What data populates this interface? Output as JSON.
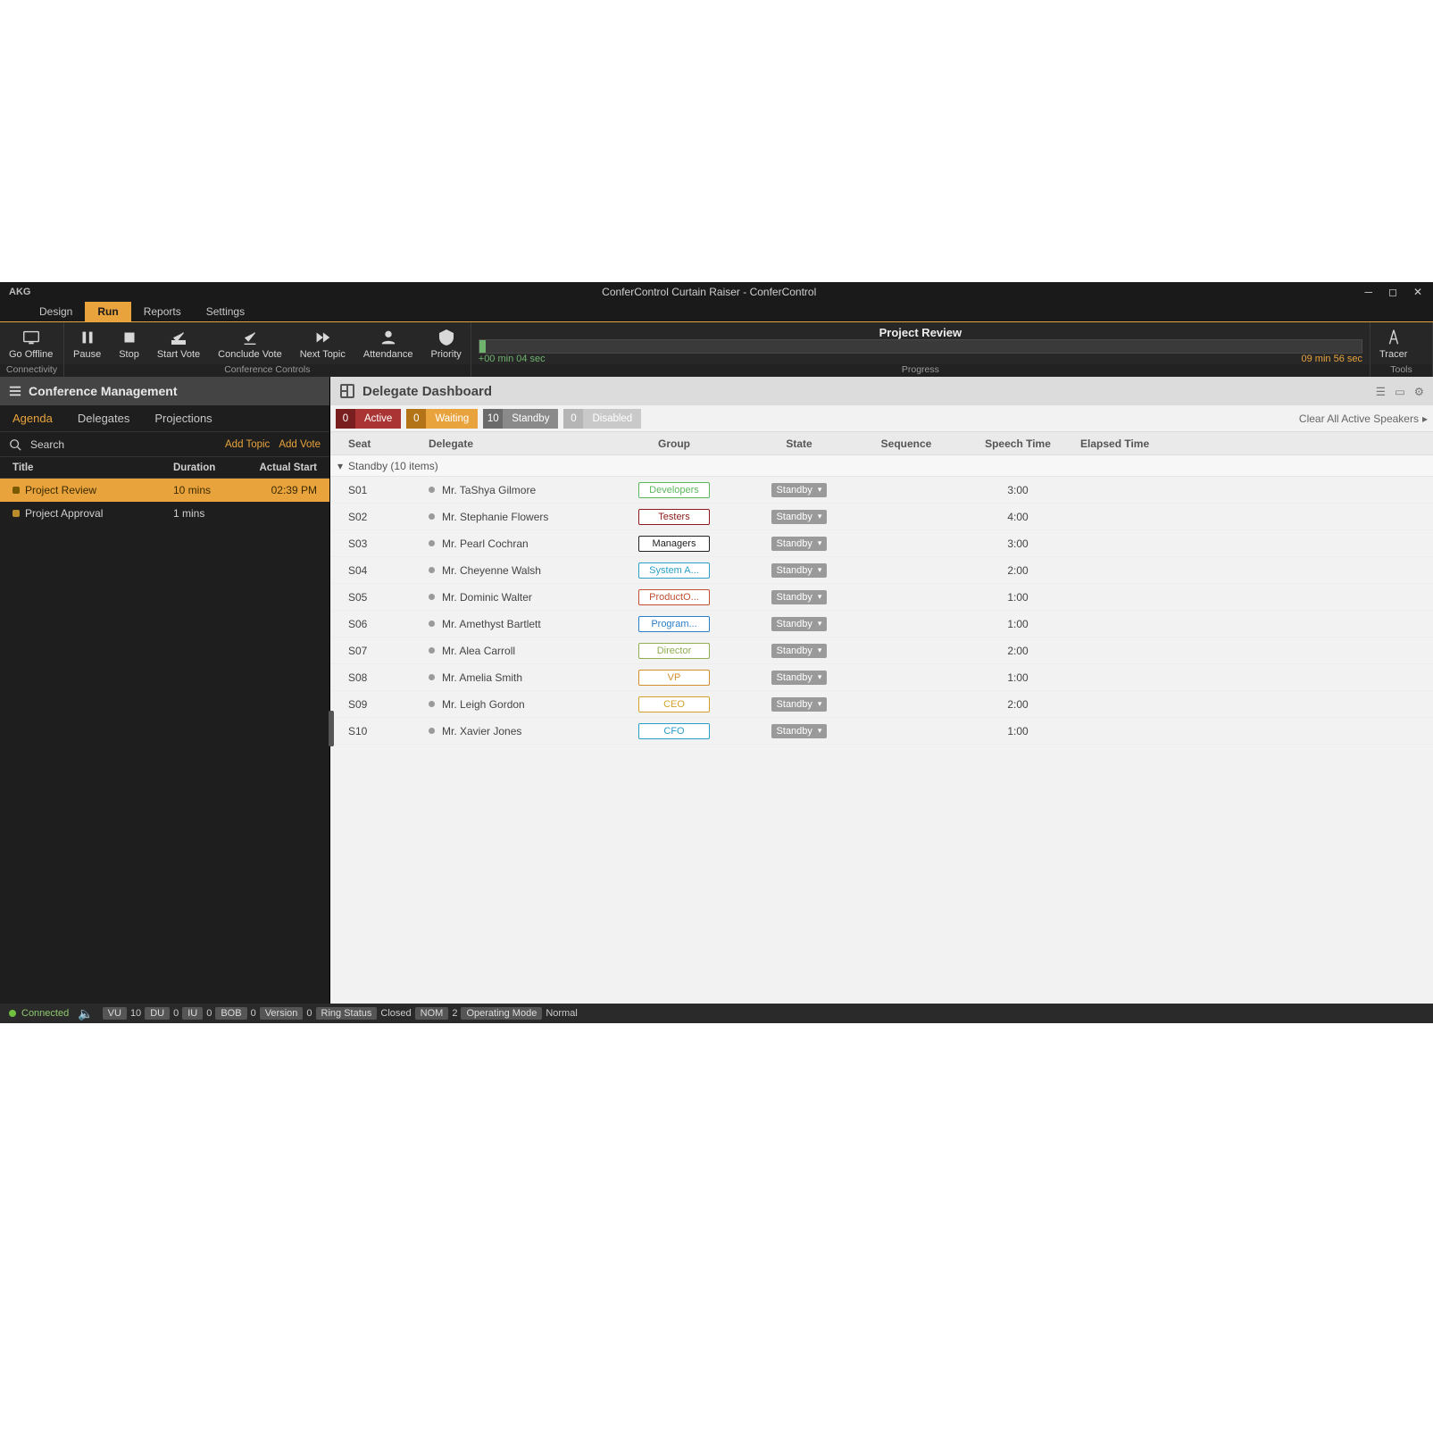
{
  "app": {
    "brand": "AKG",
    "title": "ConferControl Curtain Raiser - ConferControl"
  },
  "menu": [
    "Design",
    "Run",
    "Reports",
    "Settings"
  ],
  "menu_active_index": 1,
  "ribbon": {
    "connectivity": {
      "label": "Connectivity",
      "buttons": [
        {
          "id": "go-offline",
          "label": "Go Offline"
        }
      ]
    },
    "conference": {
      "label": "Conference Controls",
      "buttons": [
        {
          "id": "pause",
          "label": "Pause"
        },
        {
          "id": "stop",
          "label": "Stop"
        },
        {
          "id": "start-vote",
          "label": "Start Vote"
        },
        {
          "id": "conclude-vote",
          "label": "Conclude Vote"
        },
        {
          "id": "next-topic",
          "label": "Next Topic"
        },
        {
          "id": "attendance",
          "label": "Attendance"
        },
        {
          "id": "priority",
          "label": "Priority"
        }
      ]
    },
    "progress": {
      "label": "Progress",
      "title": "Project Review",
      "elapsed": "+00 min  04 sec",
      "remaining": "09 min  56 sec",
      "percent": 0.7
    },
    "tools": {
      "label": "Tools",
      "buttons": [
        {
          "id": "tracer",
          "label": "Tracer"
        }
      ]
    }
  },
  "sidebar": {
    "title": "Conference Management",
    "tabs": [
      "Agenda",
      "Delegates",
      "Projections"
    ],
    "active_tab": 0,
    "search_label": "Search",
    "add_topic": "Add Topic",
    "add_vote": "Add Vote",
    "columns": {
      "title": "Title",
      "duration": "Duration",
      "actual_start": "Actual Start"
    },
    "rows": [
      {
        "title": "Project Review",
        "duration": "10 mins",
        "start": "02:39 PM",
        "selected": true
      },
      {
        "title": "Project Approval",
        "duration": "1 mins",
        "start": "",
        "selected": false
      }
    ]
  },
  "dashboard": {
    "title": "Delegate Dashboard",
    "filters": [
      {
        "id": "active",
        "count": 0,
        "label": "Active"
      },
      {
        "id": "waiting",
        "count": 0,
        "label": "Waiting"
      },
      {
        "id": "standby",
        "count": 10,
        "label": "Standby"
      },
      {
        "id": "disabled",
        "count": 0,
        "label": "Disabled"
      }
    ],
    "clear_link": "Clear All Active Speakers",
    "columns": [
      "Seat",
      "Delegate",
      "Group",
      "State",
      "Sequence",
      "Speech Time",
      "Elapsed Time"
    ],
    "group_header": "Standby (10 items)",
    "group_colors": {
      "Developers": "#5cb85c",
      "Testers": "#8b1a1a",
      "Managers": "#222222",
      "System A...": "#2aa0c8",
      "ProductO...": "#c05030",
      "Program...": "#2a7ec8",
      "Director": "#8fae4f",
      "VP": "#d48f2a",
      "CEO": "#d4a02a",
      "CFO": "#2a9cc8"
    },
    "rows": [
      {
        "seat": "S01",
        "delegate": "Mr. TaShya Gilmore",
        "group": "Developers",
        "state": "Standby",
        "speech": "3:00"
      },
      {
        "seat": "S02",
        "delegate": "Mr. Stephanie Flowers",
        "group": "Testers",
        "state": "Standby",
        "speech": "4:00"
      },
      {
        "seat": "S03",
        "delegate": "Mr. Pearl Cochran",
        "group": "Managers",
        "state": "Standby",
        "speech": "3:00"
      },
      {
        "seat": "S04",
        "delegate": "Mr. Cheyenne Walsh",
        "group": "System A...",
        "state": "Standby",
        "speech": "2:00"
      },
      {
        "seat": "S05",
        "delegate": "Mr. Dominic Walter",
        "group": "ProductO...",
        "state": "Standby",
        "speech": "1:00"
      },
      {
        "seat": "S06",
        "delegate": "Mr. Amethyst Bartlett",
        "group": "Program...",
        "state": "Standby",
        "speech": "1:00"
      },
      {
        "seat": "S07",
        "delegate": "Mr. Alea Carroll",
        "group": "Director",
        "state": "Standby",
        "speech": "2:00"
      },
      {
        "seat": "S08",
        "delegate": "Mr. Amelia Smith",
        "group": "VP",
        "state": "Standby",
        "speech": "1:00"
      },
      {
        "seat": "S09",
        "delegate": "Mr. Leigh Gordon",
        "group": "CEO",
        "state": "Standby",
        "speech": "2:00"
      },
      {
        "seat": "S10",
        "delegate": "Mr. Xavier Jones",
        "group": "CFO",
        "state": "Standby",
        "speech": "1:00"
      }
    ]
  },
  "statusbar": {
    "connected": "Connected",
    "chips": [
      {
        "k": "VU",
        "v": "10"
      },
      {
        "k": "DU",
        "v": "0"
      },
      {
        "k": "IU",
        "v": "0"
      },
      {
        "k": "BOB",
        "v": "0"
      },
      {
        "k": "Version",
        "v": "0"
      },
      {
        "k": "Ring Status",
        "v": "Closed"
      },
      {
        "k": "NOM",
        "v": "2"
      },
      {
        "k": "Operating Mode",
        "v": "Normal"
      }
    ]
  }
}
